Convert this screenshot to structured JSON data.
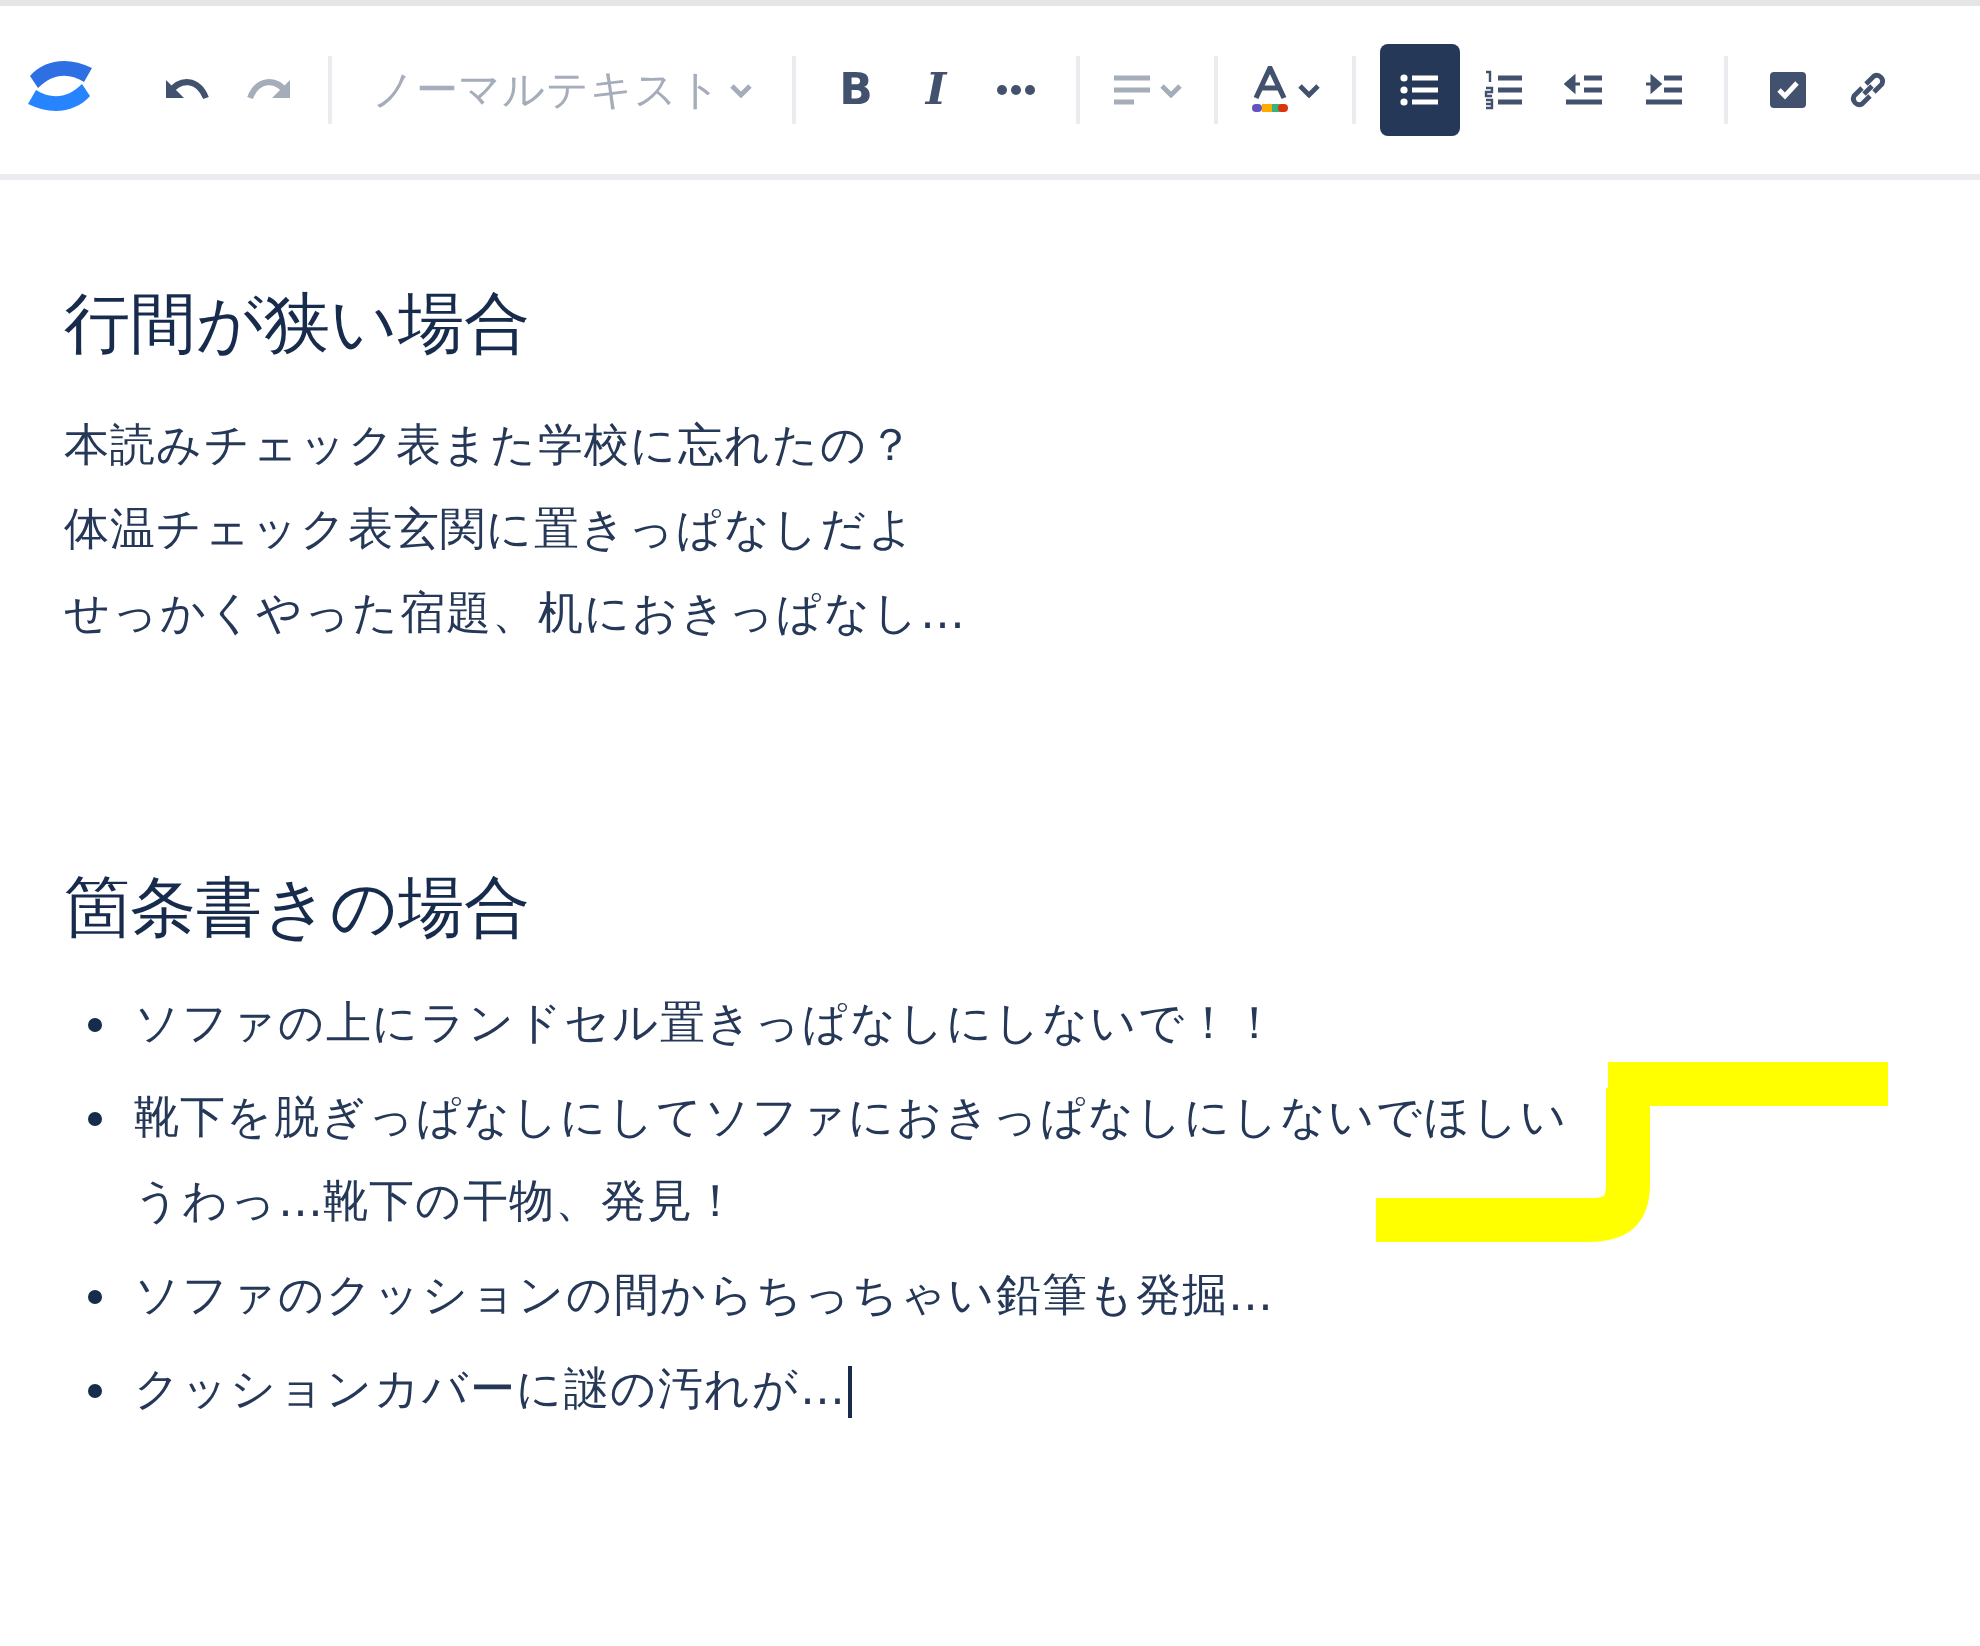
{
  "toolbar": {
    "groups": [
      [
        {
          "kind": "undo",
          "disabled": false,
          "selected": false
        },
        {
          "kind": "redo",
          "disabled": true,
          "selected": false
        }
      ],
      [
        {
          "kind": "text-style",
          "label": "ノーマルテキスト",
          "disabled": true,
          "selected": false
        }
      ],
      [
        {
          "kind": "bold",
          "label": "B",
          "disabled": false,
          "selected": false
        },
        {
          "kind": "italic",
          "label": "I",
          "disabled": false,
          "selected": false
        },
        {
          "kind": "more",
          "disabled": false,
          "selected": false
        }
      ],
      [
        {
          "kind": "align",
          "disabled": true,
          "selected": false
        }
      ],
      [
        {
          "kind": "text-color",
          "disabled": false,
          "selected": false
        }
      ],
      [
        {
          "kind": "bullet-list",
          "disabled": false,
          "selected": true
        },
        {
          "kind": "numbered-list",
          "disabled": false,
          "selected": false
        },
        {
          "kind": "outdent",
          "disabled": false,
          "selected": false
        },
        {
          "kind": "indent",
          "disabled": false,
          "selected": false
        }
      ],
      [
        {
          "kind": "task",
          "disabled": false,
          "selected": false
        },
        {
          "kind": "link",
          "disabled": false,
          "selected": false
        }
      ]
    ]
  },
  "content": [
    {
      "kind": "heading",
      "text": "行間が狭い場合"
    },
    {
      "kind": "paragraph",
      "lines": [
        "本読みチェック表また学校に忘れたの？",
        "体温チェック表玄関に置きっぱなしだよ",
        "せっかくやった宿題、机におきっぱなし…"
      ]
    },
    {
      "kind": "heading",
      "text": "箇条書きの場合"
    },
    {
      "kind": "bullets",
      "items": [
        {
          "lines": [
            "ソファの上にランドセル置きっぱなしにしないで！！"
          ],
          "cursor": false
        },
        {
          "lines": [
            "靴下を脱ぎっぱなしにしてソファにおきっぱなしにしないでほしい",
            "うわっ…靴下の干物、発見！"
          ],
          "cursor": false
        },
        {
          "lines": [
            "ソファのクッションの間からちっちゃい鉛筆も発掘…"
          ],
          "cursor": false
        },
        {
          "lines": [
            "クッションカバーに謎の汚れが…"
          ],
          "cursor": true
        }
      ]
    }
  ]
}
